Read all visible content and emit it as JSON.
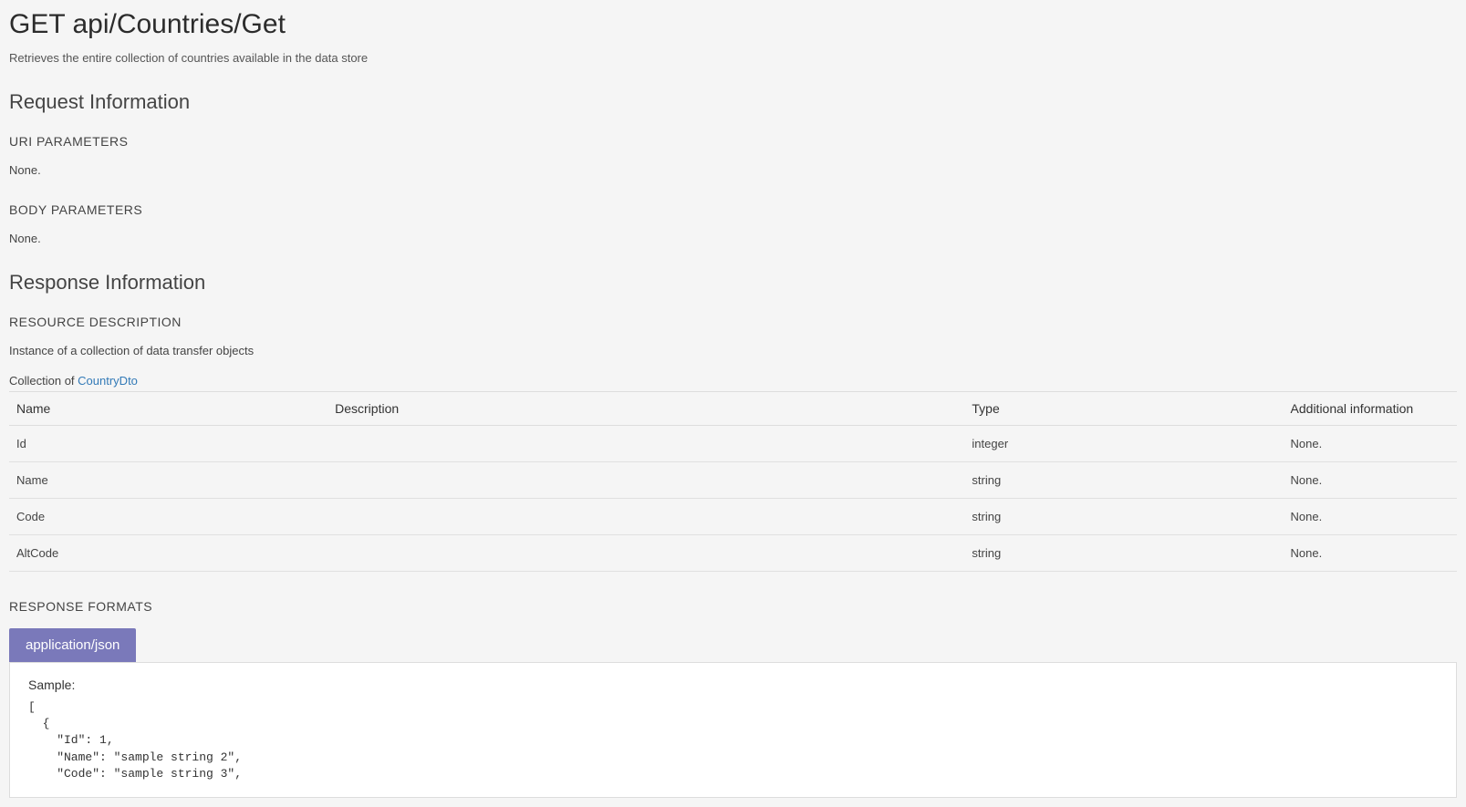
{
  "page_title": "GET api/Countries/Get",
  "page_description": "Retrieves the entire collection of countries available in the data store",
  "request": {
    "heading": "Request Information",
    "uri_params_heading": "URI PARAMETERS",
    "uri_params_value": "None.",
    "body_params_heading": "BODY PARAMETERS",
    "body_params_value": "None."
  },
  "response": {
    "heading": "Response Information",
    "resource_desc_heading": "RESOURCE DESCRIPTION",
    "resource_desc_text": "Instance of a collection of data transfer objects",
    "collection_prefix": "Collection of ",
    "collection_link_text": "CountryDto",
    "table": {
      "headers": {
        "name": "Name",
        "description": "Description",
        "type": "Type",
        "additional": "Additional information"
      },
      "rows": [
        {
          "name": "Id",
          "description": "",
          "type": "integer",
          "additional": "None."
        },
        {
          "name": "Name",
          "description": "",
          "type": "string",
          "additional": "None."
        },
        {
          "name": "Code",
          "description": "",
          "type": "string",
          "additional": "None."
        },
        {
          "name": "AltCode",
          "description": "",
          "type": "string",
          "additional": "None."
        }
      ]
    },
    "formats_heading": "RESPONSE FORMATS",
    "tab_label": "application/json",
    "sample_label": "Sample:",
    "sample_code": "[\n  {\n    \"Id\": 1,\n    \"Name\": \"sample string 2\",\n    \"Code\": \"sample string 3\","
  }
}
